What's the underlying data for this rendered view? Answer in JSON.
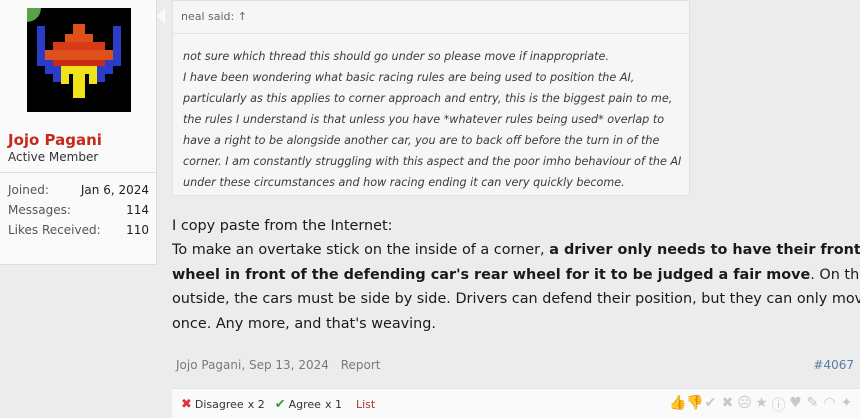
{
  "user": {
    "name": "Jojo Pagani",
    "title": "Active Member",
    "stats": [
      {
        "label": "Joined:",
        "value": "Jan 6, 2024"
      },
      {
        "label": "Messages:",
        "value": "114"
      },
      {
        "label": "Likes Received:",
        "value": "110"
      }
    ]
  },
  "quote": {
    "header": "neal said: ↑",
    "lines": [
      "not sure which thread this should go under so please move if inappropriate.",
      "I have been wondering what basic racing rules are being used to position the AI,",
      "particularly as this applies to corner approach and entry, this is the biggest pain to me,",
      "the rules I understand is that unless you have *whatever rules being used* overlap to",
      "have a right to be alongside another car, you are to back off before the turn in of the",
      "corner. I am constantly struggling with this aspect and the poor imho behaviour of the AI",
      "under these circumstances and how racing ending it can very quickly become."
    ]
  },
  "post": {
    "line1": "I copy paste from the Internet:",
    "line2_pre": "To make an overtake stick on the inside of a corner, ",
    "line2_bold": "a driver only needs to have their front",
    "line3_bold": "wheel in front of the defending car's rear wheel for it to be judged a fair move",
    "line3_post": ". On the",
    "line4": "outside, the cars must be side by side. Drivers can defend their position, but they can only move",
    "line5": "once. Any more, and that's weaving."
  },
  "meta": {
    "author": "Jojo Pagani",
    "date": "Sep 13, 2024",
    "report": "Report",
    "post_number": "#4067"
  },
  "reactions": {
    "disagree_label": "Disagree",
    "disagree_count": "x 2",
    "agree_label": "Agree",
    "agree_count": "x 1",
    "list_label": "List",
    "icons": [
      "thumbs-up-icon",
      "thumbs-down-icon",
      "check-icon",
      "cross-icon",
      "sad-icon",
      "star-icon",
      "info-icon",
      "heart-icon",
      "wrench-icon",
      "rainbow-icon",
      "lightbulb-icon"
    ]
  },
  "colors": {
    "username": "#c5291b",
    "post_number": "#5a7ca5",
    "background": "#ececec"
  }
}
